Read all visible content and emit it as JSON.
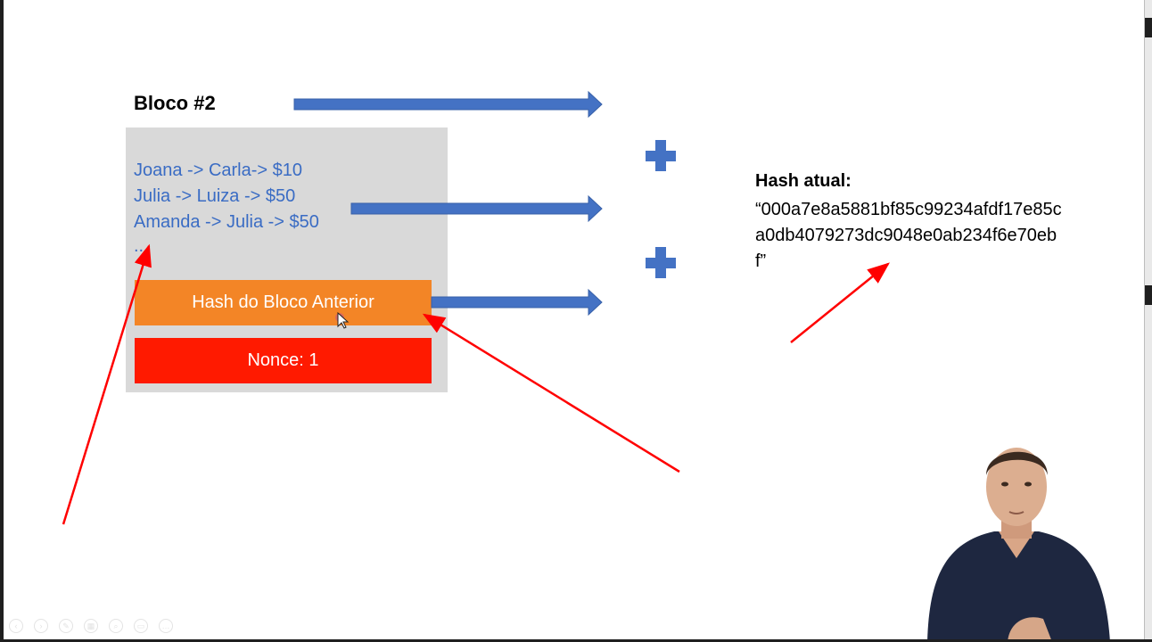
{
  "slide": {
    "title": "Bloco #2",
    "transactions": [
      "Joana -> Carla-> $10",
      "Julia -> Luiza -> $50",
      "Amanda -> Julia -> $50"
    ],
    "ellipsis": "...",
    "previous_hash_label": "Hash do Bloco Anterior",
    "nonce_label": "Nonce: 1",
    "current_hash_label": "Hash atual:",
    "current_hash_value": "“000a7e8a5881bf85c99234afdf17e85ca0db4079273dc9048e0ab234f6e70ebf”"
  },
  "colors": {
    "arrow_blue": "#4472c4",
    "text_blue": "#3a6cc4",
    "panel_gray": "#d9d9d9",
    "orange": "#f38526",
    "red": "#ff1a00",
    "annotation_red": "#ff0000"
  },
  "icons": {
    "plus": "plus-icon",
    "arrow": "arrow-right-icon",
    "cursor": "mouse-cursor-icon"
  }
}
